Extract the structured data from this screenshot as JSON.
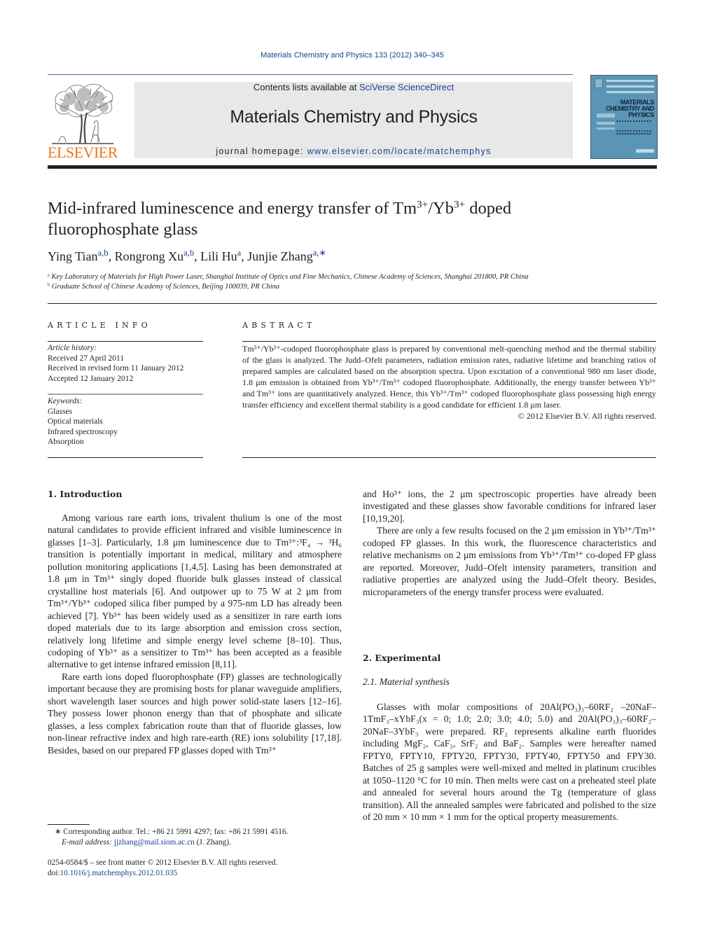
{
  "header": {
    "citation": "Materials Chemistry and Physics 133 (2012) 340–345",
    "publisher_logo_text": "ELSEVIER",
    "contents_prefix": "Contents lists available at ",
    "contents_link": "SciVerse ScienceDirect",
    "journal_title": "Materials Chemistry and Physics",
    "homepage_prefix": "journal homepage: ",
    "homepage_link": "www.elsevier.com/locate/matchemphys",
    "cover": {
      "line1": "MATERIALS",
      "line2": "CHEMISTRY AND",
      "line3": "PHYSICS",
      "background_color": "#5b95b6"
    },
    "colors": {
      "link": "#1f3f8f",
      "elsevier_orange": "#e87722",
      "banner_grey": "#e8e8e9"
    }
  },
  "article": {
    "title_parts": {
      "a": "Mid-infrared luminescence and energy transfer of Tm",
      "sup1": "3+",
      "b": "/Yb",
      "sup2": "3+",
      "c": " doped",
      "line2": "fluorophosphate glass"
    },
    "authors": [
      {
        "name": "Ying Tian",
        "affil": "a,b",
        "sep": ", "
      },
      {
        "name": "Rongrong Xu",
        "affil": "a,b",
        "sep": ", "
      },
      {
        "name": "Lili Hu",
        "affil": "a",
        "sep": ", "
      },
      {
        "name": "Junjie Zhang",
        "affil": "a,∗",
        "sep": ""
      }
    ],
    "affiliations": [
      {
        "mark": "a",
        "text": "Key Laboratory of Materials for High Power Laser, Shanghai Institute of Optics and Fine Mechanics, Chinese Academy of Sciences, Shanghai 201800, PR China"
      },
      {
        "mark": "b",
        "text": "Graduate School of Chinese Academy of Sciences, Beijing 100039, PR China"
      }
    ]
  },
  "article_info": {
    "heading": "ARTICLE INFO",
    "history_label": "Article history:",
    "history": [
      "Received 27 April 2011",
      "Received in revised form 11 January 2012",
      "Accepted 12 January 2012"
    ],
    "keywords_label": "Keywords:",
    "keywords": [
      "Glasses",
      "Optical materials",
      "Infrared spectroscopy",
      "Absorption"
    ]
  },
  "abstract": {
    "heading": "ABSTRACT",
    "text": "Tm³⁺/Yb³⁺-codoped fluorophosphate glass is prepared by conventional melt-quenching method and the thermal stability of the glass is analyzed. The Judd–Ofelt parameters, radiation emission rates, radiative lifetime and branching ratios of prepared samples are calculated based on the absorption spectra. Upon excitation of a conventional 980 nm laser diode, 1.8 μm emission is obtained from Yb³⁺/Tm³⁺ codoped fluorophosphate. Additionally, the energy transfer between Yb³⁺ and Tm³⁺ ions are quantitatively analyzed. Hence, this Yb³⁺/Tm³⁺ codoped fluorophosphate glass possessing high energy transfer efficiency and excellent thermal stability is a good candidate for efficient 1.8 μm laser.",
    "copyright": "© 2012 Elsevier B.V. All rights reserved."
  },
  "sections": {
    "intro_heading": "1.  Introduction",
    "intro_p1": "Among various rare earth ions, trivalent thulium is one of the most natural candidates to provide efficient infrared and visible luminescence in glasses [1–3]. Particularly, 1.8 μm luminescence due to Tm³⁺:³F₄ → ³H₆ transition is potentially important in medical, military and atmosphere pollution monitoring applications [1,4,5]. Lasing has been demonstrated at 1.8 μm in Tm³⁺ singly doped fluoride bulk glasses instead of classical crystalline host materials [6]. And outpower up to 75 W at 2 μm from Tm³⁺/Yb³⁺ codoped silica fiber pumped by a 975-nm LD has already been achieved [7]. Yb³⁺ has been widely used as a sensitizer in rare earth ions doped materials due to its large absorption and emission cross section, relatively long lifetime and simple energy level scheme [8–10]. Thus, codoping of Yb³⁺ as a sensitizer to Tm³⁺ has been accepted as a feasible alternative to get intense infrared emission [8,11].",
    "intro_p2": "Rare earth ions doped fluorophosphate (FP) glasses are technologically important because they are promising hosts for planar waveguide amplifiers, short wavelength laser sources and high power solid-state lasers [12–16]. They possess lower phonon energy than that of phosphate and silicate glasses, a less complex fabrication route than that of fluoride glasses, low non-linear refractive index and high rare-earth (RE) ions solubility [17,18]. Besides, based on our prepared FP glasses doped with Tm³⁺",
    "col2_cont": "and Ho³⁺ ions, the 2 μm spectroscopic properties have already been investigated and these glasses show favorable conditions for infrared laser [10,19,20].",
    "intro_p3": "There are only a few results focused on the 2 μm emission in Yb³⁺/Tm³⁺ codoped FP glasses. In this work, the fluorescence characteristics and relative mechanisms on 2 μm emissions from Yb³⁺/Tm³⁺ co-doped FP glass are reported. Moreover, Judd–Ofelt intensity parameters, transition and radiative properties are analyzed using the Judd–Ofelt theory. Besides, microparameters of the energy transfer process were evaluated.",
    "exp_heading": "2.  Experimental",
    "exp_sub": "2.1.  Material synthesis",
    "exp_p1": "Glasses with molar compositions of 20Al(PO₃)₃–60RF₂ –20NaF–1TmF₃–xYbF₃(x = 0; 1.0; 2.0; 3.0; 4.0; 5.0) and 20Al(PO₃)₃–60RF₂–20NaF–3YbF₃ were prepared. RF₂ represents alkaline earth fluorides including MgF₂, CaF₂, SrF₂ and BaF₂. Samples were hereafter named FPTY0, FPTY10, FPTY20, FPTY30, FPTY40, FPTY50 and FPY30. Batches of 25 g samples were well-mixed and melted in platinum crucibles at 1050–1120 °C for 10 min. Then melts were cast on a preheated steel plate and annealed for several hours around the Tg (temperature of glass transition). All the annealed samples were fabricated and polished to the size of 20 mm × 10 mm × 1 mm for the optical property measurements."
  },
  "footnotes": {
    "corresponding": "∗  Corresponding author. Tel.: +86 21 5991 4297; fax: +86 21 5991 4516.",
    "email_label": "E-mail address: ",
    "email": "jjzhang@mail.siom.ac.cn",
    "email_suffix": " (J. Zhang).",
    "issn_line": "0254-0584/$ – see front matter © 2012 Elsevier B.V. All rights reserved.",
    "doi_prefix": "doi:",
    "doi": "10.1016/j.matchemphys.2012.01.035"
  }
}
